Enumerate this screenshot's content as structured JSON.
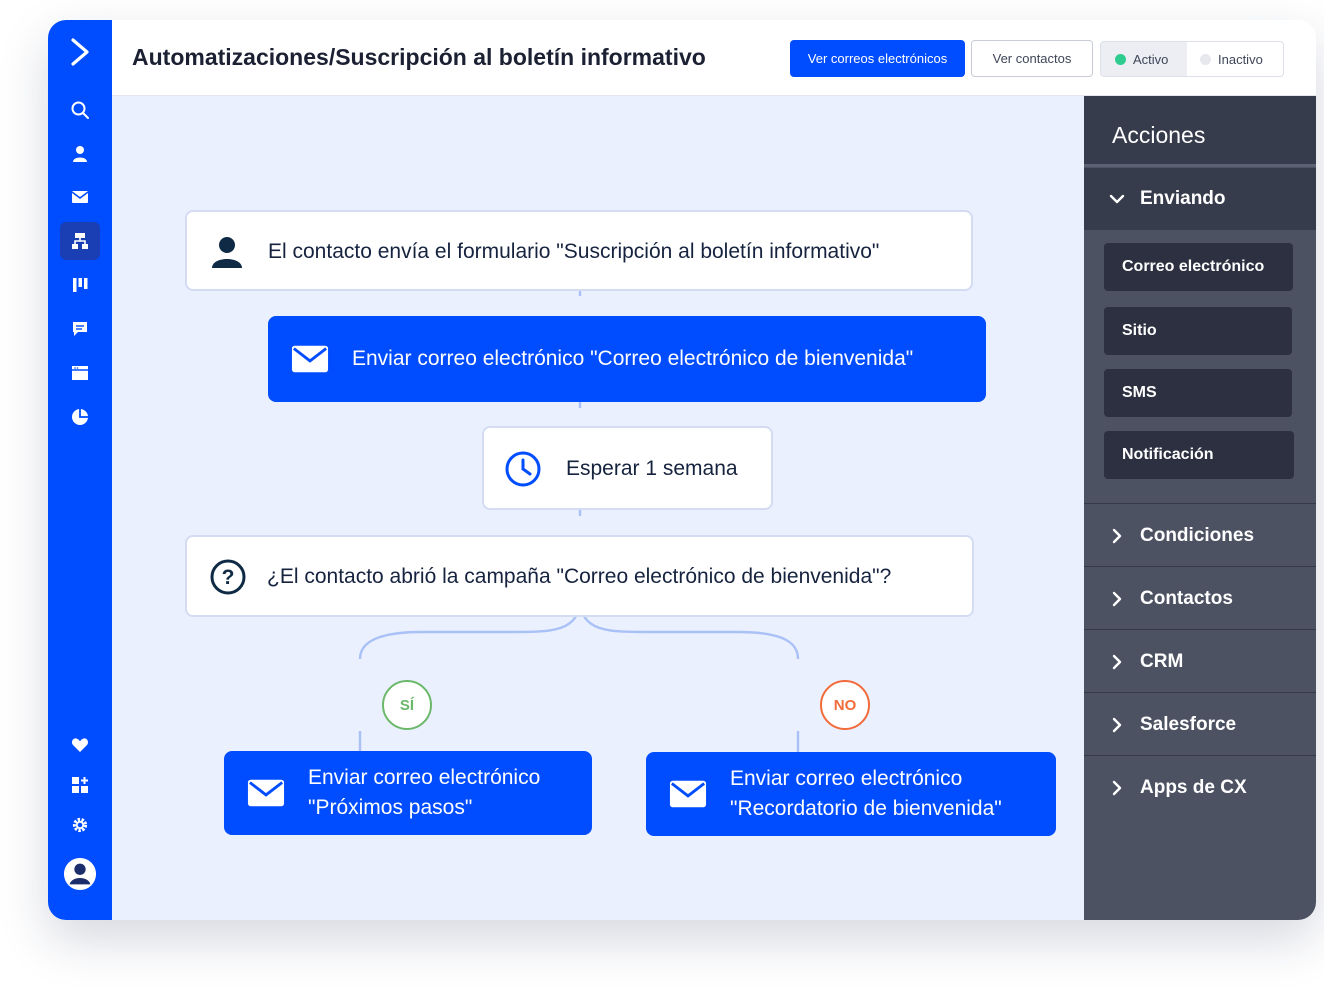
{
  "header": {
    "title": "Automatizaciones/Suscripción al boletín informativo",
    "view_emails_button": "Ver correos electrónicos",
    "view_contacts_button": "Ver contactos",
    "status_toggle": {
      "active_label": "Activo",
      "inactive_label": "Inactivo",
      "selected": "Activo",
      "active_color": "#2ecc8f",
      "inactive_color": "#e6e8ee"
    }
  },
  "sidebar": {
    "accent_color": "#004cff",
    "icons": [
      "logo-icon",
      "search-icon",
      "contacts-icon",
      "email-icon",
      "automations-icon",
      "pipelines-icon",
      "conversations-icon",
      "website-icon",
      "reports-icon",
      "heart-icon",
      "apps-icon",
      "settings-icon",
      "user-avatar-icon"
    ],
    "active_item": "automations-icon"
  },
  "workflow": {
    "trigger": {
      "icon": "person-icon",
      "text": "El contacto envía el formulario \"Suscripción al boletín informativo\""
    },
    "send_welcome": {
      "icon": "envelope-icon",
      "text": "Enviar correo electrónico \"Correo electrónico de bienvenida\""
    },
    "wait": {
      "icon": "clock-icon",
      "text": "Esperar 1 semana"
    },
    "condition": {
      "icon": "question-icon",
      "text": "¿El contacto abrió la campaña \"Correo electrónico de bienvenida\"?"
    },
    "yes_label": "SÍ",
    "no_label": "NO",
    "yes_color": "#6bb86b",
    "no_color": "#f26b3a",
    "yes_action": {
      "icon": "envelope-icon",
      "line1": "Enviar correo electrónico",
      "line2": "\"Próximos pasos\""
    },
    "no_action": {
      "icon": "envelope-icon",
      "line1": "Enviar correo electrónico",
      "line2": "\"Recordatorio de bienvenida\""
    }
  },
  "actions_panel": {
    "title": "Acciones",
    "expanded_section": {
      "label": "Enviando",
      "items": [
        "Correo electrónico",
        "Sitio",
        "SMS",
        "Notificación"
      ]
    },
    "collapsed_sections": [
      "Condiciones",
      "Contactos",
      "CRM",
      "Salesforce",
      "Apps de CX"
    ]
  }
}
